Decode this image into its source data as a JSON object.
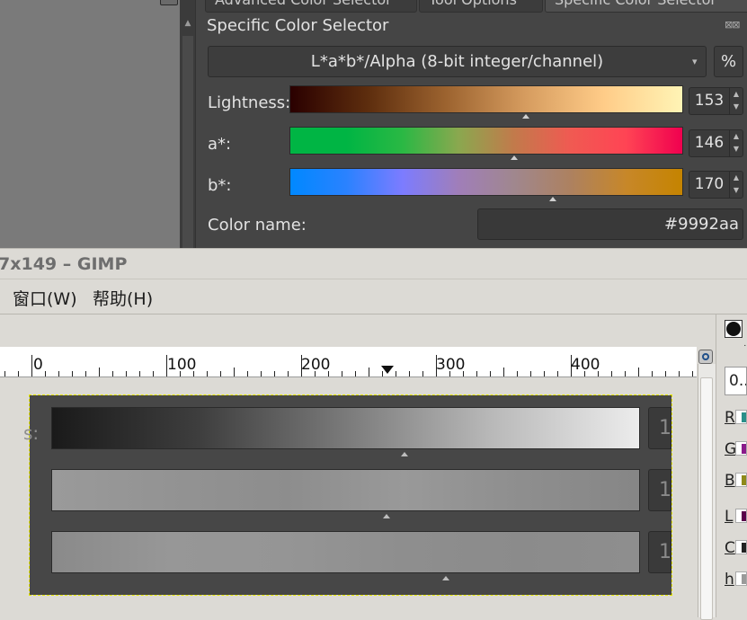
{
  "dialog": {
    "tabs": [
      {
        "label": "Advanced Color Selector",
        "active": false
      },
      {
        "label": "Tool Options",
        "active": false
      },
      {
        "label": "Specific Color Selector",
        "active": true
      }
    ],
    "panel_title": "Specific Color Selector",
    "panel_close_glyph": "⊠⊠",
    "color_model_dropdown": "L*a*b*/Alpha (8-bit integer/channel)",
    "percent_button": "%",
    "sliders": [
      {
        "label": "Lightness:",
        "value": "153",
        "level": 0.6,
        "gradient": [
          "#2a0000",
          "#5e2e0e",
          "#9d6430",
          "#d69c5f",
          "#ffcc88",
          "#fff4b5"
        ]
      },
      {
        "label": "a*:",
        "value": "146",
        "level": 0.57,
        "gradient": [
          "#00b544",
          "#00b544",
          "#2ab844",
          "#8aa84f",
          "#c27a4b",
          "#f05a52",
          "#ff4454",
          "#f0004f"
        ]
      },
      {
        "label": "b*:",
        "value": "170",
        "level": 0.67,
        "gradient": [
          "#0088ff",
          "#2a82ff",
          "#7c7cff",
          "#a07eb9",
          "#a0878e",
          "#ad8160",
          "#c78729",
          "#c58400"
        ]
      }
    ],
    "color_name_label": "Color name:",
    "color_name_value": "#9992aa"
  },
  "gimp": {
    "window_title": "7x149 – GIMP",
    "menus": [
      {
        "label": "窗口(W)"
      },
      {
        "label": "帮助(H)"
      }
    ],
    "ruler_labels": [
      "0",
      "100",
      "200",
      "300",
      "400"
    ],
    "canvas_label_fragment": "s:",
    "canvas_value_fragment": "1",
    "canvas_bars": [
      {
        "gradient": [
          "#1a1a1a",
          "#3e3e3e",
          "#7a7a7a",
          "#b9b9b9",
          "#ececec"
        ],
        "level": 0.6
      },
      {
        "gradient": [
          "#9a9a9a",
          "#939393",
          "#8d8d8d",
          "#999",
          "#8e8e8e",
          "#868686"
        ],
        "level": 0.57
      },
      {
        "gradient": [
          "#8a8a8a",
          "#979797",
          "#959595",
          "#8e8e8e",
          "#8b8b8b",
          "#8e8e8e"
        ],
        "level": 0.67
      }
    ]
  },
  "dock": {
    "field_value": "0..",
    "channels": [
      {
        "letter": "R",
        "color": "#2a8f8a"
      },
      {
        "letter": "G",
        "color": "#8a1a8a"
      },
      {
        "letter": "B",
        "color": "#8f8a1a"
      },
      {
        "letter": "L",
        "color": "#5a004a"
      },
      {
        "letter": "C",
        "color": "#222222"
      },
      {
        "letter": "h",
        "color": "#9a9a9a"
      }
    ]
  }
}
